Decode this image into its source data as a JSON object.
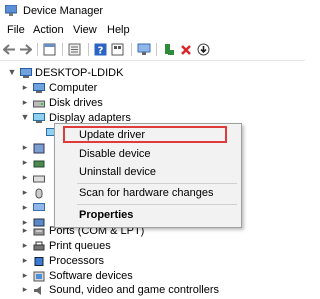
{
  "window": {
    "title": "Device Manager"
  },
  "menu": [
    "File",
    "Action",
    "View",
    "Help"
  ],
  "toolbar": {
    "icons": [
      "back-arrow-icon",
      "forward-arrow-icon",
      "properties-window-icon",
      "list-view-icon",
      "help-icon",
      "details-icon",
      "monitor-scan-icon",
      "add-driver-icon",
      "remove-x-icon",
      "download-driver-icon"
    ]
  },
  "tree": {
    "root": "DESKTOP-LDIDK",
    "items": [
      {
        "label": "Computer",
        "icon": "computer-icon"
      },
      {
        "label": "Disk drives",
        "icon": "disk-drive-icon"
      },
      {
        "label": "Display adapters",
        "icon": "display-adapter-icon"
      },
      {
        "label": "Ports (COM & LPT)",
        "icon": "port-icon"
      },
      {
        "label": "Print queues",
        "icon": "printer-icon"
      },
      {
        "label": "Processors",
        "icon": "processor-icon"
      },
      {
        "label": "Software devices",
        "icon": "software-device-icon"
      },
      {
        "label": "Sound, video and game controllers",
        "icon": "sound-icon"
      }
    ]
  },
  "context_menu": {
    "items": [
      "Update driver",
      "Disable device",
      "Uninstall device",
      "Scan for hardware changes",
      "Properties"
    ],
    "highlight_color": "#e03a3a"
  }
}
